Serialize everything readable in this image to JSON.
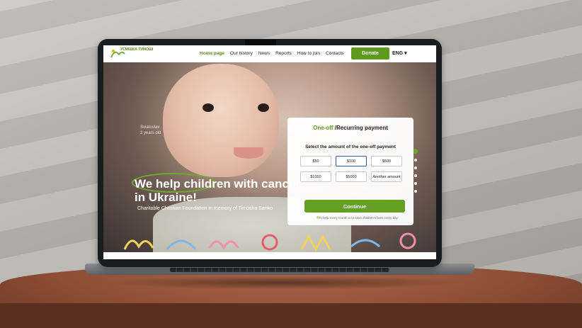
{
  "nav": {
    "logo_text": "УСМІШКА ТИМОШІ",
    "items": [
      "Home page",
      "Our history",
      "News",
      "Reports",
      "How to join",
      "Contacts"
    ],
    "donate": "Donate",
    "lang": "ENG ▾"
  },
  "hero": {
    "child_name": "Sviatoslav",
    "child_age": "2 years old",
    "headline": "We help children with cancer in Ukraine!",
    "subline": "Charitable Christian Foundation in memory of Timosha Sanko"
  },
  "donation": {
    "title_one": "One-off",
    "title_rest": " /Recurring payment",
    "subtitle": "Select the amount of the one-off payment",
    "amounts": [
      "$50",
      "$100",
      "$500",
      "$1000",
      "$5000",
      "Another amount"
    ],
    "selected_index": 1,
    "continue": "Continue",
    "note": "To help every month is to save children's lives every day"
  },
  "colors": {
    "accent": "#5e9a1d",
    "selected_border": "#2a5aa8"
  },
  "slider": {
    "count": 6,
    "active": 0
  }
}
